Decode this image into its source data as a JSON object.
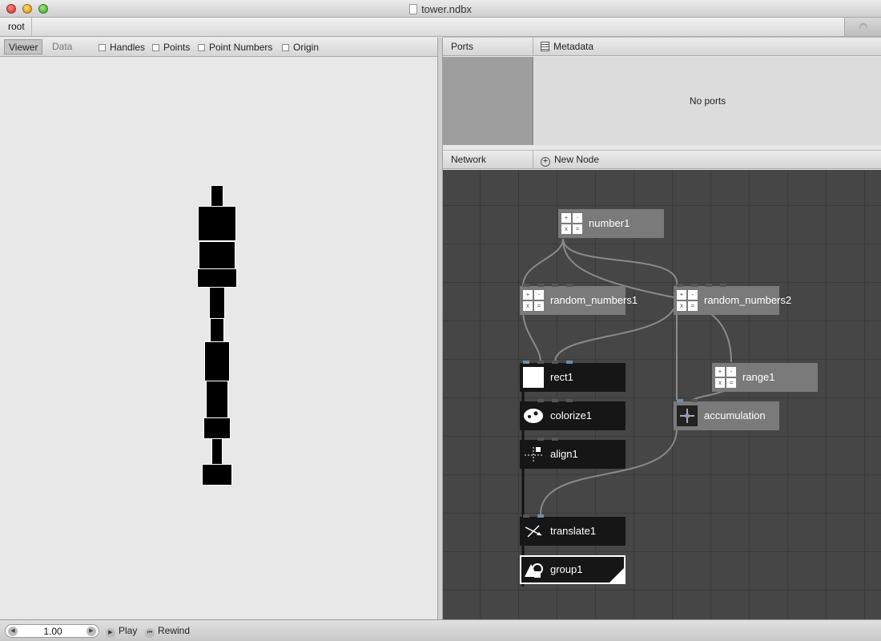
{
  "window": {
    "title": "tower.ndbx"
  },
  "breadcrumb": {
    "root": "root"
  },
  "viewer": {
    "tabs": [
      "Viewer",
      "Data"
    ],
    "options": [
      "Handles",
      "Points",
      "Point Numbers",
      "Origin"
    ]
  },
  "ports": {
    "tab_ports": "Ports",
    "tab_metadata": "Metadata",
    "empty_text": "No ports"
  },
  "network": {
    "header": "Network",
    "new_node": "New Node",
    "nodes": {
      "number1": "number1",
      "random_numbers1": "random_numbers1",
      "random_numbers2": "random_numbers2",
      "rect1": "rect1",
      "range1": "range1",
      "colorize1": "colorize1",
      "accumulation": "accumulation",
      "align1": "align1",
      "translate1": "translate1",
      "group1": "group1"
    },
    "calc_symbols": [
      "+",
      "-",
      "x",
      "="
    ]
  },
  "playback": {
    "frame": "1.00",
    "play": "Play",
    "rewind": "Rewind"
  },
  "colors": {
    "network_bg": "#464646",
    "node_light": "#7a7a7a",
    "node_dark": "#161616",
    "wire": "#8a8a8a",
    "port_active": "#6b8ea8"
  }
}
